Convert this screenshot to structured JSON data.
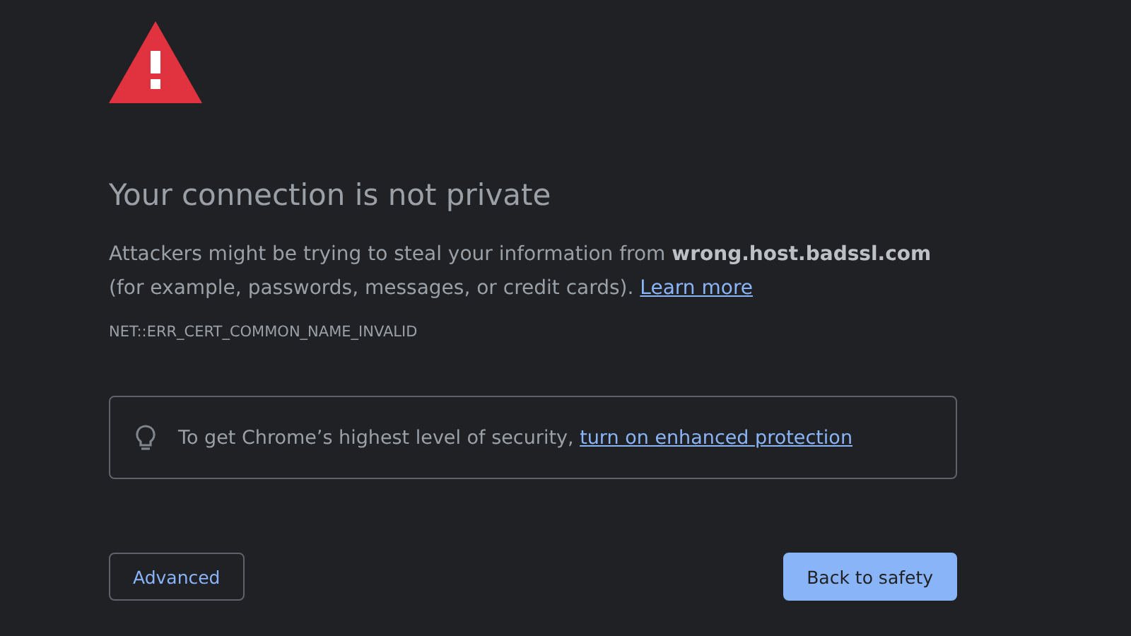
{
  "title": "Your connection is not private",
  "description": {
    "text": "Attackers might be trying to steal your information from **wrong.host.badssl.com** (for example, passwords, messages, or credit cards).",
    "link": "Learn more"
  },
  "error_code": "NET::ERR_CERT_COMMON_NAME_INVALID",
  "tip": {
    "text": "To get Chrome’s highest level of security,",
    "link": "turn on enhanced protection"
  },
  "buttons": [
    {
      "kind": "secondary",
      "label": "Advanced"
    },
    {
      "kind": "primary",
      "label": "Back to safety"
    }
  ]
}
